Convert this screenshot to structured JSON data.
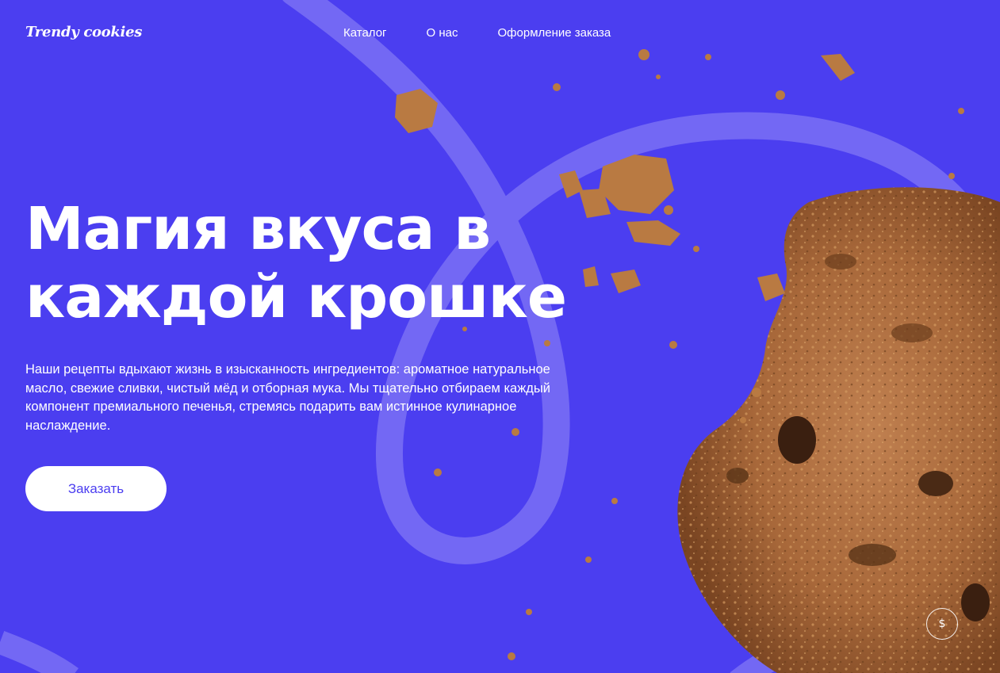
{
  "header": {
    "logo_text": "Trendy cookies",
    "nav": [
      {
        "label": "Каталог"
      },
      {
        "label": "О нас"
      },
      {
        "label": "Оформление заказа"
      }
    ]
  },
  "hero": {
    "title_line1": "Магия вкуса в",
    "title_line2": "каждой крошке",
    "description": "Наши рецепты вдыхают жизнь в изысканность ингредиентов: ароматное натуральное масло, свежие сливки, чистый мёд и отборная мука. Мы тщательно отбираем каждый компонент премиального печенья, стремясь подарить вам истинное кулинарное наслаждение.",
    "cta_label": "Заказать"
  },
  "floating_button": {
    "icon": "dollar-icon",
    "glyph": "$"
  },
  "colors": {
    "background": "#4b3ef0",
    "loop_stroke": "#7a70f5",
    "button_bg": "#ffffff",
    "button_text": "#4b3ef0",
    "cookie_base": "#a8683a",
    "cookie_light": "#c98b52",
    "cookie_dark": "#5a3418"
  }
}
